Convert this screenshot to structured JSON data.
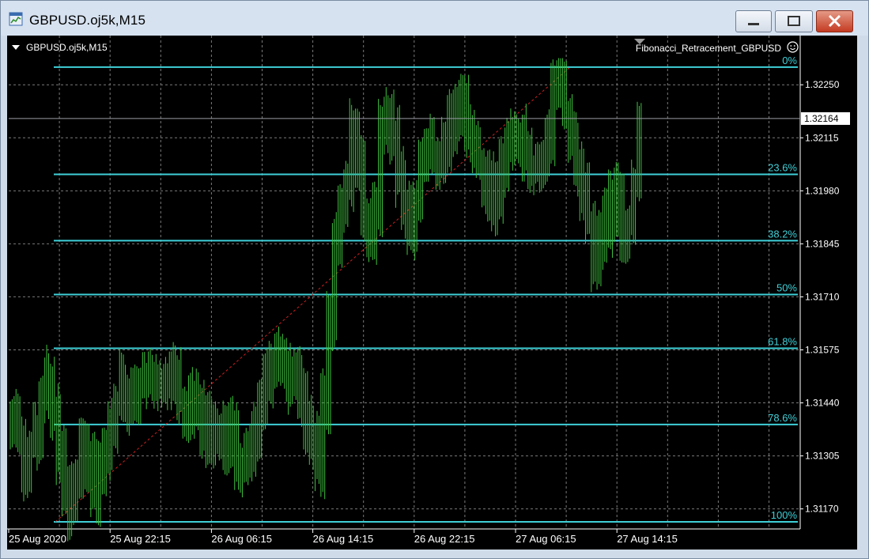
{
  "window": {
    "title": "GBPUSD.oj5k,M15",
    "buttons": [
      "minimize",
      "maximize",
      "close"
    ]
  },
  "chart": {
    "symbol_label": "GBPUSD.oj5k,M15",
    "indicator_label": "Fibonacci_Retracement_GBPUSD",
    "current_price": "1.32164",
    "colors": {
      "background": "#000000",
      "candles": "#3fc33f",
      "fib_lines": "#3fd0d8",
      "grid": "#7a7a7a",
      "trendline": "#d02020",
      "text": "#ffffff"
    }
  },
  "chart_data": {
    "type": "line",
    "title": "",
    "x_tick_labels": [
      "25 Aug 2020",
      "25 Aug 22:15",
      "26 Aug 06:15",
      "26 Aug 14:15",
      "26 Aug 22:15",
      "27 Aug 06:15",
      "27 Aug 14:15"
    ],
    "y_tick_labels": [
      "1.32250",
      "1.32115",
      "1.31980",
      "1.31845",
      "1.31710",
      "1.31575",
      "1.31440",
      "1.31305",
      "1.31170"
    ],
    "ylim": [
      1.31125,
      1.32335
    ],
    "fib_levels": [
      {
        "label": "0%",
        "price": 1.32295
      },
      {
        "label": "23.6%",
        "price": 1.32022
      },
      {
        "label": "38.2%",
        "price": 1.31853
      },
      {
        "label": "50%",
        "price": 1.31716
      },
      {
        "label": "61.8%",
        "price": 1.31579
      },
      {
        "label": "78.6%",
        "price": 1.31385
      },
      {
        "label": "100%",
        "price": 1.31137
      }
    ],
    "close_series": [
      1.314,
      1.3135,
      1.3128,
      1.3132,
      1.3138,
      1.3145,
      1.315,
      1.3142,
      1.313,
      1.3122,
      1.3117,
      1.3125,
      1.3132,
      1.3128,
      1.312,
      1.3125,
      1.3132,
      1.3138,
      1.3145,
      1.3148,
      1.3145,
      1.3148,
      1.315,
      1.3152,
      1.315,
      1.3148,
      1.315,
      1.3152,
      1.315,
      1.3145,
      1.314,
      1.3145,
      1.3142,
      1.3138,
      1.3133,
      1.3135,
      1.3133,
      1.3138,
      1.3135,
      1.313,
      1.3128,
      1.3132,
      1.3138,
      1.3145,
      1.315,
      1.3155,
      1.3158,
      1.3155,
      1.315,
      1.3152,
      1.3145,
      1.314,
      1.3135,
      1.3128,
      1.3145,
      1.3165,
      1.3185,
      1.3192,
      1.32,
      1.3212,
      1.3205,
      1.319,
      1.3185,
      1.3195,
      1.3215,
      1.3218,
      1.321,
      1.32,
      1.3195,
      1.319,
      1.3195,
      1.3205,
      1.321,
      1.3208,
      1.3205,
      1.321,
      1.3215,
      1.322,
      1.3222,
      1.3215,
      1.321,
      1.3205,
      1.32,
      1.3195,
      1.3198,
      1.3205,
      1.321,
      1.3212,
      1.321,
      1.3208,
      1.3205,
      1.3203,
      1.3205,
      1.321,
      1.3225,
      1.3222,
      1.3218,
      1.321,
      1.3205,
      1.3198,
      1.319,
      1.3178,
      1.3185,
      1.319,
      1.3195,
      1.3198,
      1.3185,
      1.319,
      1.32,
      1.3216
    ],
    "trendline": {
      "from_price": 1.31137,
      "to_price": 1.32295
    }
  }
}
